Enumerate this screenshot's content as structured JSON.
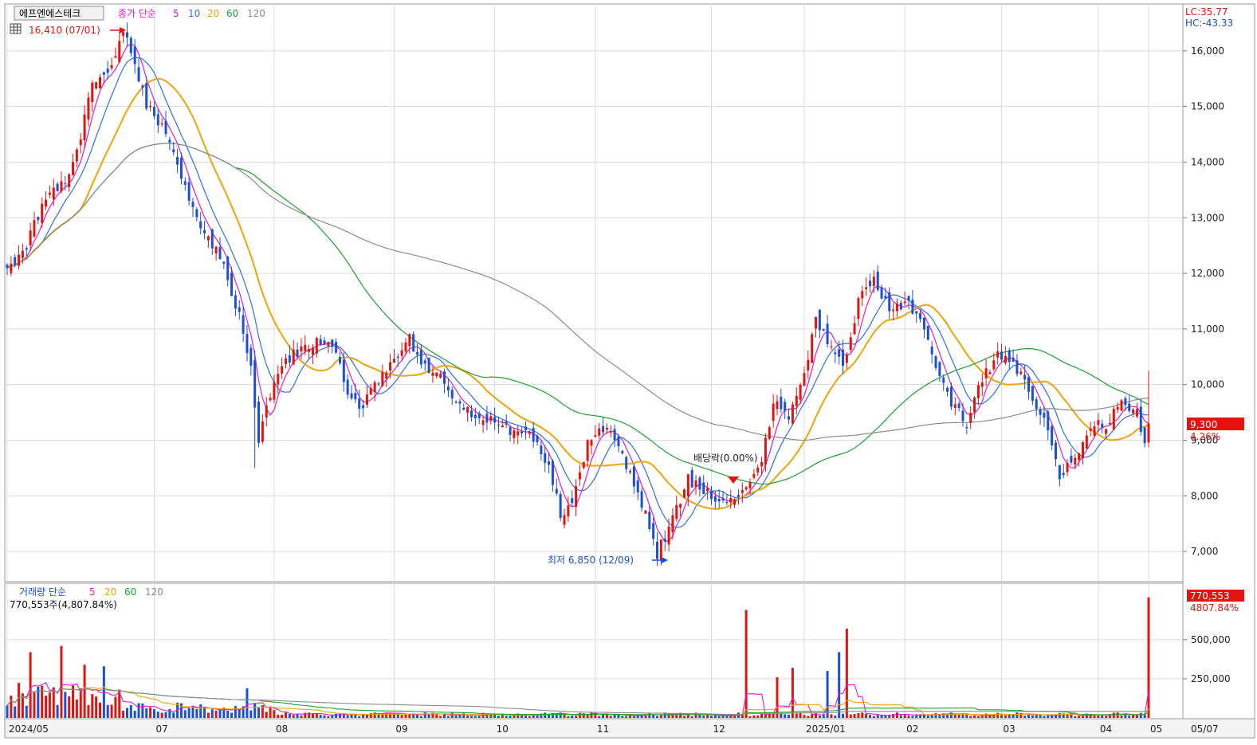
{
  "title": "에프엔에스테크",
  "price_legend": {
    "label": "종가 단순",
    "periods": [
      "5",
      "10",
      "20",
      "60",
      "120"
    ]
  },
  "volume_legend": {
    "label": "거래량 단순",
    "periods": [
      "5",
      "20",
      "60",
      "120"
    ]
  },
  "volume_info": "770,553주(4,807.84%)",
  "high_marker": "16,410 (07/01)",
  "low_marker": "최저 6,850 (12/09)",
  "dividend_marker": "배당락(0.00%)",
  "lc_label": "LC:35.77",
  "hc_label": "HC:-43.33",
  "current_price_badge": "9,300",
  "current_change": "4.26%",
  "current_volume_badge": "770,553",
  "current_volume_pct": "4807.84%",
  "colors": {
    "up": "#e3140f",
    "down": "#1a4fd6",
    "ma5": "#e01cd2",
    "ma10": "#2f6fe8",
    "ma20": "#f0a30a",
    "ma60": "#1aa32f",
    "ma120": "#8c8c8c",
    "grid": "#dcdcdc"
  },
  "chart_data": [
    {
      "type": "candlestick",
      "title": "에프엔에스테크",
      "y_ticks": [
        7000,
        8000,
        9000,
        10000,
        11000,
        12000,
        13000,
        14000,
        15000,
        16000
      ],
      "y_tick_labels": [
        "7,000",
        "8,000",
        "9,000",
        "10,000",
        "11,000",
        "12,000",
        "13,000",
        "14,000",
        "15,000",
        "16,000"
      ],
      "ylim": [
        6500,
        16800
      ],
      "x_labels": [
        "2024/05",
        "07",
        "08",
        "09",
        "10",
        "11",
        "12",
        "2025/01",
        "02",
        "03",
        "04",
        "05",
        "05/07"
      ],
      "high": {
        "value": 16410,
        "date": "07/01"
      },
      "low": {
        "value": 6850,
        "date": "12/09"
      },
      "last_close": 9300,
      "keypoints": [
        [
          0,
          12100
        ],
        [
          5,
          12500
        ],
        [
          10,
          13400
        ],
        [
          15,
          13600
        ],
        [
          18,
          14200
        ],
        [
          22,
          15400
        ],
        [
          26,
          15600
        ],
        [
          30,
          16300
        ],
        [
          33,
          15800
        ],
        [
          36,
          15000
        ],
        [
          40,
          14600
        ],
        [
          45,
          13800
        ],
        [
          48,
          13200
        ],
        [
          52,
          12600
        ],
        [
          56,
          12200
        ],
        [
          60,
          11200
        ],
        [
          63,
          10300
        ],
        [
          65,
          9000
        ],
        [
          70,
          10300
        ],
        [
          75,
          10600
        ],
        [
          80,
          10800
        ],
        [
          85,
          10600
        ],
        [
          88,
          9800
        ],
        [
          92,
          9600
        ],
        [
          96,
          10100
        ],
        [
          100,
          10500
        ],
        [
          104,
          10800
        ],
        [
          108,
          10300
        ],
        [
          112,
          10100
        ],
        [
          116,
          9700
        ],
        [
          120,
          9500
        ],
        [
          125,
          9400
        ],
        [
          130,
          9200
        ],
        [
          135,
          9100
        ],
        [
          140,
          8600
        ],
        [
          143,
          7700
        ],
        [
          146,
          7800
        ],
        [
          150,
          8900
        ],
        [
          154,
          9200
        ],
        [
          158,
          8900
        ],
        [
          162,
          8200
        ],
        [
          166,
          7500
        ],
        [
          168,
          6950
        ],
        [
          172,
          7600
        ],
        [
          176,
          8300
        ],
        [
          180,
          8100
        ],
        [
          185,
          7900
        ],
        [
          190,
          8100
        ],
        [
          195,
          8600
        ],
        [
          198,
          9700
        ],
        [
          202,
          9400
        ],
        [
          206,
          10200
        ],
        [
          209,
          11200
        ],
        [
          212,
          10800
        ],
        [
          216,
          10300
        ],
        [
          220,
          11500
        ],
        [
          224,
          11900
        ],
        [
          228,
          11300
        ],
        [
          232,
          11500
        ],
        [
          236,
          11200
        ],
        [
          240,
          10400
        ],
        [
          244,
          9700
        ],
        [
          248,
          9300
        ],
        [
          252,
          10100
        ],
        [
          256,
          10500
        ],
        [
          260,
          10400
        ],
        [
          264,
          9900
        ],
        [
          268,
          9400
        ],
        [
          272,
          8300
        ],
        [
          276,
          8700
        ],
        [
          280,
          9300
        ],
        [
          284,
          9300
        ],
        [
          288,
          9700
        ],
        [
          292,
          9500
        ],
        [
          294,
          8900
        ],
        [
          295,
          9300
        ]
      ],
      "series": [
        {
          "name": "5",
          "window": 5
        },
        {
          "name": "10",
          "window": 10
        },
        {
          "name": "20",
          "window": 20
        },
        {
          "name": "60",
          "window": 60
        },
        {
          "name": "120",
          "window": 120
        }
      ]
    },
    {
      "type": "bar",
      "title": "거래량",
      "y_ticks": [
        250000,
        500000
      ],
      "y_tick_labels": [
        "250,000",
        "500,000"
      ],
      "ylim": [
        0,
        820000
      ],
      "last_volume": 770553,
      "spikes": [
        [
          6,
          420000
        ],
        [
          14,
          460000
        ],
        [
          20,
          340000
        ],
        [
          25,
          330000
        ],
        [
          62,
          190000
        ],
        [
          191,
          690000
        ],
        [
          199,
          260000
        ],
        [
          203,
          320000
        ],
        [
          212,
          300000
        ],
        [
          215,
          420000
        ],
        [
          217,
          570000
        ],
        [
          295,
          770553
        ]
      ],
      "series": [
        {
          "name": "5",
          "window": 5
        },
        {
          "name": "20",
          "window": 20
        },
        {
          "name": "60",
          "window": 60
        },
        {
          "name": "120",
          "window": 120
        }
      ]
    }
  ]
}
